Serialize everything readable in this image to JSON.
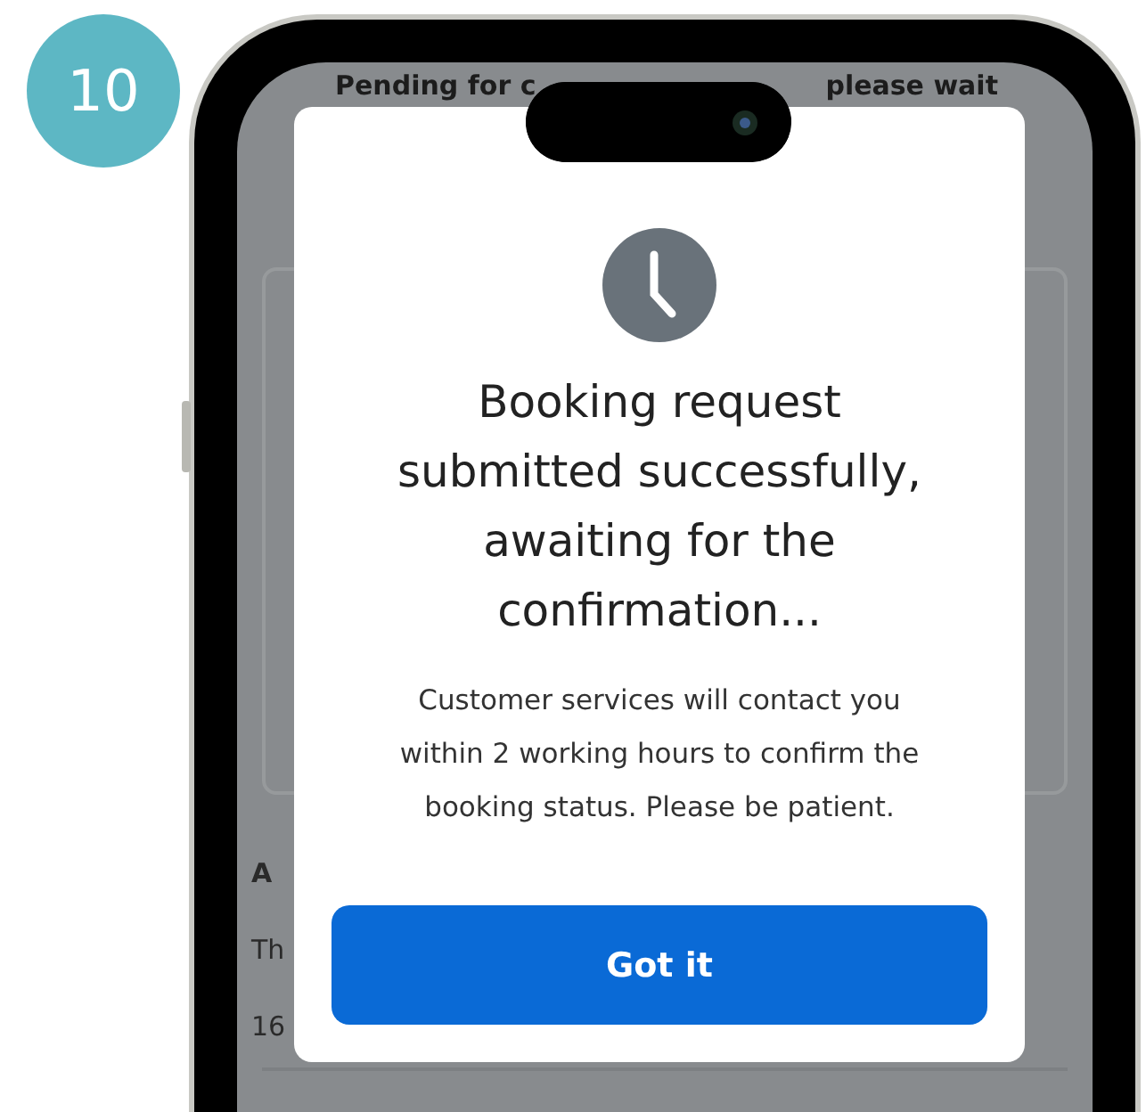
{
  "step_badge": "10",
  "background": {
    "heading_parts": [
      "Pending for c",
      "please wait"
    ],
    "fragments": [
      {
        "kind": "heading",
        "text": "A"
      },
      {
        "kind": "plain",
        "text": "Th"
      },
      {
        "kind": "plain",
        "text": "16"
      }
    ]
  },
  "dialog": {
    "title": "Booking request submitted successfully, awaiting for the confirmation...",
    "message": "Customer services will contact you within 2 working hours to confirm the booking status. Please be patient.",
    "button": "Got it"
  }
}
